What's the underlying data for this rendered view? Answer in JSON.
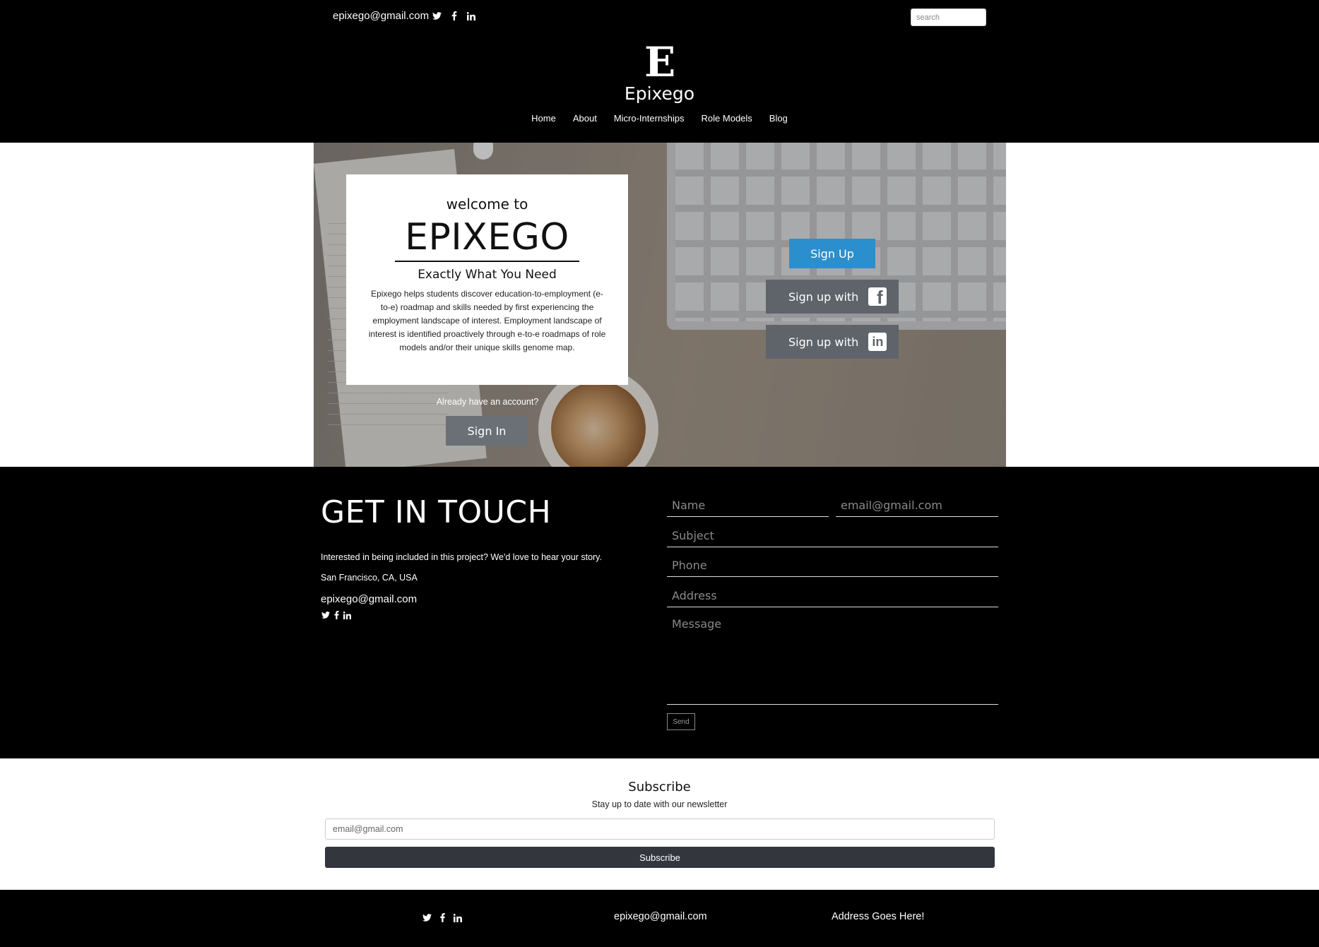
{
  "topbar": {
    "email": "epixego@gmail.com",
    "socials": [
      "twitter-icon",
      "facebook-icon",
      "linkedin-icon"
    ],
    "search_placeholder": "search"
  },
  "header": {
    "logo_letter": "E",
    "brand": "Epixego",
    "nav": [
      "Home",
      "About",
      "Micro-Internships",
      "Role Models",
      "Blog"
    ]
  },
  "hero": {
    "welcome": "welcome to",
    "title": "EPIXEGO",
    "tagline": "Exactly What You Need",
    "description": "Epixego helps students discover education-to-employment (e-to-e) roadmap and skills needed by first experiencing the employment landscape of interest. Employment landscape of interest is identified proactively through e-to-e roadmaps of role models and/or their unique skills genome map.",
    "already": "Already have an account?",
    "signin": "Sign In",
    "signup": "Sign Up",
    "signup_with": "Sign up with",
    "signup_with_2": "Sign up with"
  },
  "contact": {
    "title": "GET IN TOUCH",
    "text": "Interested in being included in this project? We'd love to hear your story.",
    "location": "San Francisco, CA, USA",
    "email": "epixego@gmail.com",
    "form": {
      "name_placeholder": "Name",
      "email_placeholder": "email@gmail.com",
      "subject_placeholder": "Subject",
      "phone_placeholder": "Phone",
      "address_placeholder": "Address",
      "message_placeholder": "Message",
      "send": "Send"
    }
  },
  "subscribe": {
    "title": "Subscribe",
    "subtitle": "Stay up to date with our newsletter",
    "email_placeholder": "email@gmail.com",
    "button": "Subscribe"
  },
  "footer": {
    "email": "epixego@gmail.com",
    "address": "Address Goes Here!"
  },
  "colors": {
    "background": "#000000",
    "signup_blue": "#2b8fcd",
    "button_gray": "#6b7077",
    "subscribe_button": "#33373d"
  }
}
